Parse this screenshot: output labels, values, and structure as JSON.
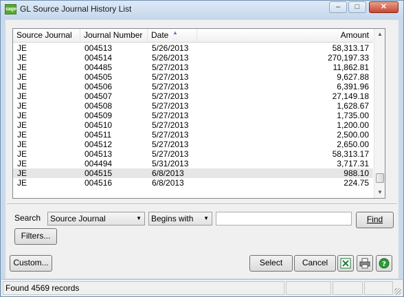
{
  "window": {
    "title": "GL Source Journal History List",
    "app_icon_text": "sage"
  },
  "columns": [
    "Source Journal",
    "Journal Number",
    "Date",
    "Amount"
  ],
  "rows": [
    {
      "source": "JE",
      "number": "004513",
      "date": "5/26/2013",
      "amount": "58,313.17"
    },
    {
      "source": "JE",
      "number": "004514",
      "date": "5/26/2013",
      "amount": "270,197.33"
    },
    {
      "source": "JE",
      "number": "004485",
      "date": "5/27/2013",
      "amount": "11,862.81"
    },
    {
      "source": "JE",
      "number": "004505",
      "date": "5/27/2013",
      "amount": "9,627.88"
    },
    {
      "source": "JE",
      "number": "004506",
      "date": "5/27/2013",
      "amount": "6,391.96"
    },
    {
      "source": "JE",
      "number": "004507",
      "date": "5/27/2013",
      "amount": "27,149.18"
    },
    {
      "source": "JE",
      "number": "004508",
      "date": "5/27/2013",
      "amount": "1,628.67"
    },
    {
      "source": "JE",
      "number": "004509",
      "date": "5/27/2013",
      "amount": "1,735.00"
    },
    {
      "source": "JE",
      "number": "004510",
      "date": "5/27/2013",
      "amount": "1,200.00"
    },
    {
      "source": "JE",
      "number": "004511",
      "date": "5/27/2013",
      "amount": "2,500.00"
    },
    {
      "source": "JE",
      "number": "004512",
      "date": "5/27/2013",
      "amount": "2,650.00"
    },
    {
      "source": "JE",
      "number": "004513",
      "date": "5/27/2013",
      "amount": "58,313.17"
    },
    {
      "source": "JE",
      "number": "004494",
      "date": "5/31/2013",
      "amount": "3,717.31"
    },
    {
      "source": "JE",
      "number": "004515",
      "date": "6/8/2013",
      "amount": "988.10"
    },
    {
      "source": "JE",
      "number": "004516",
      "date": "6/8/2013",
      "amount": "224.75"
    }
  ],
  "selected_row": 13,
  "search": {
    "label": "Search",
    "field_value": "Source Journal",
    "operator_value": "Begins with",
    "text_value": "",
    "find_label": "Find",
    "filters_label": "Filters..."
  },
  "buttons": {
    "custom_label": "Custom...",
    "select_label": "Select",
    "cancel_label": "Cancel"
  },
  "status": {
    "text": "Found 4569 records"
  },
  "icons": {
    "excel": "excel-export-icon",
    "print": "printer-icon",
    "help": "help-icon"
  },
  "colors": {
    "window_frame": "#c9d9ea",
    "excel_green": "#1e7a3a",
    "help_green": "#2e9a3a",
    "selected_row": "#e6e6e6"
  }
}
